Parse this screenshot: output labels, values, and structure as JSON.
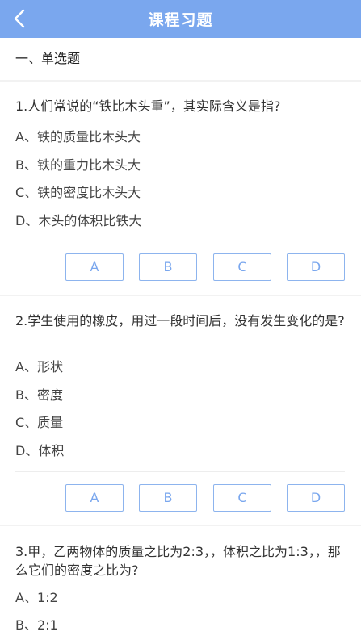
{
  "header": {
    "title": "课程习题"
  },
  "section": {
    "title": "一、单选题"
  },
  "questions": [
    {
      "text": "1.人们常说的“铁比木头重”，其实际含义是指?",
      "options": [
        "A、铁的质量比木头大",
        "B、铁的重力比木头大",
        "C、铁的密度比木头大",
        "D、木头的体积比铁大"
      ],
      "answers": [
        "A",
        "B",
        "C",
        "D"
      ]
    },
    {
      "text": "2.学生使用的橡皮，用过一段时间后，没有发生变化的是?",
      "options": [
        "A、形状",
        "B、密度",
        "C、质量",
        "D、体积"
      ],
      "answers": [
        "A",
        "B",
        "C",
        "D"
      ]
    },
    {
      "text": "3.甲，乙两物体的质量之比为2:3，，体积之比为1:3，，那么它们的密度之比为?",
      "options": [
        "A、1:2",
        "B、2:1"
      ]
    }
  ],
  "colors": {
    "header_bg": "#7aa7ee",
    "button_border": "#8db4ee",
    "button_text": "#7aa7ee",
    "page_bg": "#f2f2f2"
  },
  "icons": {
    "back": "chevron-left-icon"
  }
}
